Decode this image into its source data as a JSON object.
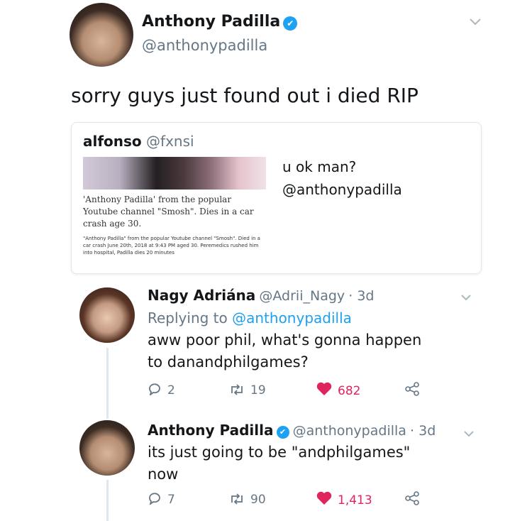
{
  "main_tweet": {
    "name": "Anthony Padilla",
    "handle": "@anthonypadilla",
    "text": "sorry guys just found out i died RIP"
  },
  "quoted_tweet": {
    "name": "alfonso",
    "handle": "@fxnsi",
    "text_line1": "u ok man?",
    "text_line2": "@anthonypadilla",
    "news_headline": "'Anthony Padilla' from the popular Youtube channel \"Smosh\". Dies in a car crash age 30.",
    "news_body": "\"Anthony Padilla\" from the popular Youtube channel \"Smosh\". Died in a car crash June 20th, 2018 at 9:43 PM aged 30. Peremedics rushed him into hospital, Padilla dies 20 minutes"
  },
  "reply1": {
    "name": "Nagy Adriána",
    "handle": "@Adrii_Nagy",
    "time": "· 3d",
    "replying_prefix": "Replying to",
    "replying_to": "@anthonypadilla",
    "text": "aww poor phil, what's gonna happen to danandphilgames?",
    "replies": "2",
    "retweets": "19",
    "likes": "682"
  },
  "reply2": {
    "name": "Anthony Padilla",
    "handle": "@anthonypadilla",
    "time": "· 3d",
    "text": "its just going to be \"andphilgames\" now",
    "replies": "7",
    "retweets": "90",
    "likes": "1,413"
  },
  "icons": {
    "verified": "verified-badge-icon",
    "chevron": "chevron-down-icon",
    "reply": "reply-icon",
    "retweet": "retweet-icon",
    "like": "heart-icon",
    "share": "share-icon"
  },
  "colors": {
    "accent": "#1da1f2",
    "like": "#e0245e",
    "muted": "#657786"
  }
}
